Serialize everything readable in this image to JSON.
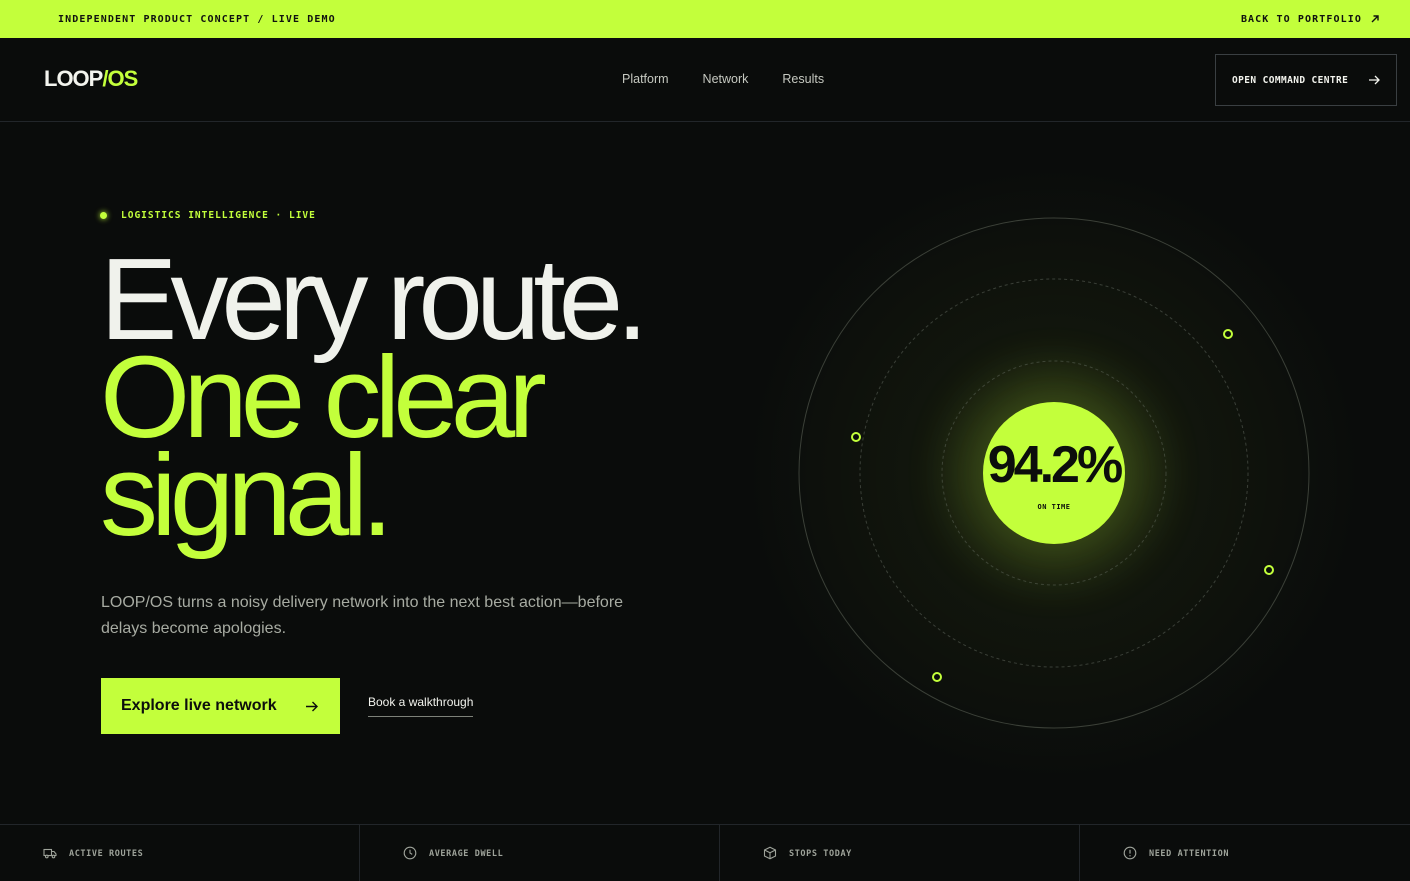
{
  "topbar": {
    "left_text": "INDEPENDENT PRODUCT CONCEPT / LIVE DEMO",
    "right_text": "BACK TO PORTFOLIO",
    "bg_color": "#c3ff3b"
  },
  "nav": {
    "logo_main": "LOOP",
    "logo_accent": "/OS",
    "links": [
      "Platform",
      "Network",
      "Results"
    ],
    "cta_label": "OPEN COMMAND CENTRE"
  },
  "hero": {
    "eyebrow": "LOGISTICS INTELLIGENCE · LIVE",
    "headline_line1": "Every route.",
    "headline_line2": "One clear",
    "headline_line3": "signal.",
    "lede": "LOOP/OS turns a noisy delivery network into the next best action—before delays become apologies.",
    "primary_cta": "Explore live network",
    "secondary_cta": "Book a walkthrough",
    "metric_value": "94.2%",
    "metric_label": "ON TIME"
  },
  "stats": [
    {
      "label": "ACTIVE ROUTES",
      "icon": "truck-icon"
    },
    {
      "label": "AVERAGE DWELL",
      "icon": "clock-icon"
    },
    {
      "label": "STOPS TODAY",
      "icon": "package-icon"
    },
    {
      "label": "NEED ATTENTION",
      "icon": "alert-icon"
    }
  ],
  "colors": {
    "accent": "#c3ff3b",
    "background": "#0a0c0b",
    "text": "#eef0ea"
  }
}
